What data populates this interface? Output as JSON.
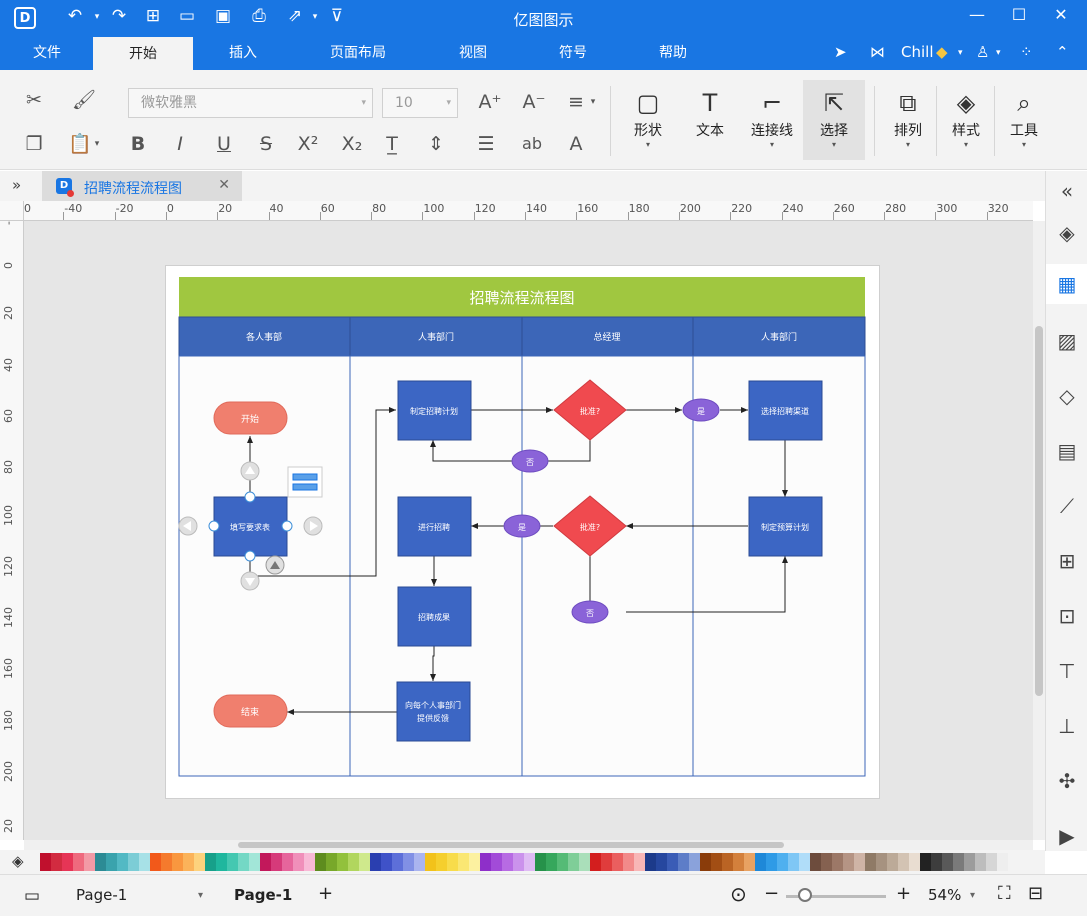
{
  "app": {
    "title": "亿图图示",
    "logo_letter": "D"
  },
  "menu": {
    "items": [
      "文件",
      "开始",
      "插入",
      "页面布局",
      "视图",
      "符号",
      "帮助"
    ],
    "active": "开始",
    "user": "Chill"
  },
  "ribbon": {
    "font_name": "微软雅黑",
    "font_size": "10",
    "tools": [
      {
        "label": "形状",
        "icon": "rectangle-icon"
      },
      {
        "label": "文本",
        "icon": "text-icon"
      },
      {
        "label": "连接线",
        "icon": "connector-icon"
      },
      {
        "label": "选择",
        "icon": "pointer-icon"
      },
      {
        "label": "排列",
        "icon": "arrange-icon"
      },
      {
        "label": "样式",
        "icon": "paint-bucket-icon"
      },
      {
        "label": "工具",
        "icon": "tools-icon"
      }
    ]
  },
  "tab": {
    "title": "招聘流程流程图"
  },
  "ruler": {
    "h_labels": [
      "-60",
      "-40",
      "-20",
      "0",
      "20",
      "40",
      "60",
      "80",
      "100",
      "120",
      "140",
      "160",
      "180",
      "200",
      "220",
      "240",
      "260",
      "280",
      "300",
      "320"
    ],
    "v_labels": [
      "-2",
      "0",
      "20",
      "40",
      "60",
      "80",
      "100",
      "120",
      "140",
      "160",
      "180",
      "200",
      "20"
    ]
  },
  "diagram": {
    "title": "招聘流程流程图",
    "title_bg": "#a0c740",
    "lanes": [
      "各人事部",
      "人事部门",
      "总经理",
      "人事部门"
    ],
    "lane_header_bg": "#3c66b8",
    "nodes": {
      "start": "开始",
      "fill_form": "填写要求表",
      "end": "结束",
      "make_plan": "制定招聘计划",
      "recruit": "进行招聘",
      "result": "招聘成果",
      "feedback_line1": "向每个人事部门",
      "feedback_line2": "提供反馈",
      "approve1": "批准?",
      "approve2": "批准?",
      "yes1": "是",
      "no1": "否",
      "yes2": "是",
      "no2": "否",
      "channel": "选择招聘渠道",
      "budget": "制定预算计划"
    },
    "colors": {
      "process": "#3c66c4",
      "terminal": "#f07f6e",
      "decision": "#f04a4f",
      "label_oval": "#8a63d8"
    }
  },
  "palette": {
    "colors": [
      "#c0102d",
      "#d22b40",
      "#e63556",
      "#ef6a7e",
      "#f39aa6",
      "#2c8b95",
      "#3aa3ad",
      "#52b9c4",
      "#7ccdd6",
      "#a7e1e7",
      "#f2591a",
      "#f57a2d",
      "#f9973f",
      "#fbb35a",
      "#fdd27d",
      "#17a08a",
      "#1fb79e",
      "#44c8b1",
      "#74d8c5",
      "#a2e6d8",
      "#c2185b",
      "#d63a7a",
      "#e6659c",
      "#f08fba",
      "#f8b9d6",
      "#5e8c1e",
      "#78a82a",
      "#92c13c",
      "#b1d65e",
      "#cfe98c",
      "#2a3fb0",
      "#3f52c8",
      "#5d6fd9",
      "#8190e5",
      "#aab4ef",
      "#f2c21a",
      "#f5cf2d",
      "#f8dc4b",
      "#fae773",
      "#fcf1a0",
      "#8e2fc9",
      "#a24bd8",
      "#b76be3",
      "#cb92ec",
      "#dfbbf4",
      "#26924a",
      "#36a75c",
      "#55bb76",
      "#7fce98",
      "#aadfba",
      "#d31e1e",
      "#e03c3c",
      "#ea5f5f",
      "#f28a8a",
      "#f8b6b6",
      "#1c3a8a",
      "#26479f",
      "#3a5cb6",
      "#5d7dc8",
      "#8aa2db",
      "#8a3c0a",
      "#a24e14",
      "#ba6424",
      "#d3803c",
      "#e8a262",
      "#1e88d8",
      "#2f9be6",
      "#4fb0ef",
      "#7fc7f5",
      "#b0ddf9",
      "#6d4c3d",
      "#856150",
      "#9c7867",
      "#b59484",
      "#cfb4a6",
      "#8f7a66",
      "#a69280",
      "#bcaa98",
      "#d3c3b3",
      "#e9ddd1",
      "#222222",
      "#3d3d3d",
      "#595959",
      "#7a7a7a",
      "#9c9c9c",
      "#bdbdbd",
      "#d6d6d6",
      "#eeeeee"
    ]
  },
  "status": {
    "page_select": "Page-1",
    "page_tab": "Page-1",
    "add_page": "+",
    "zoom": "54%"
  }
}
